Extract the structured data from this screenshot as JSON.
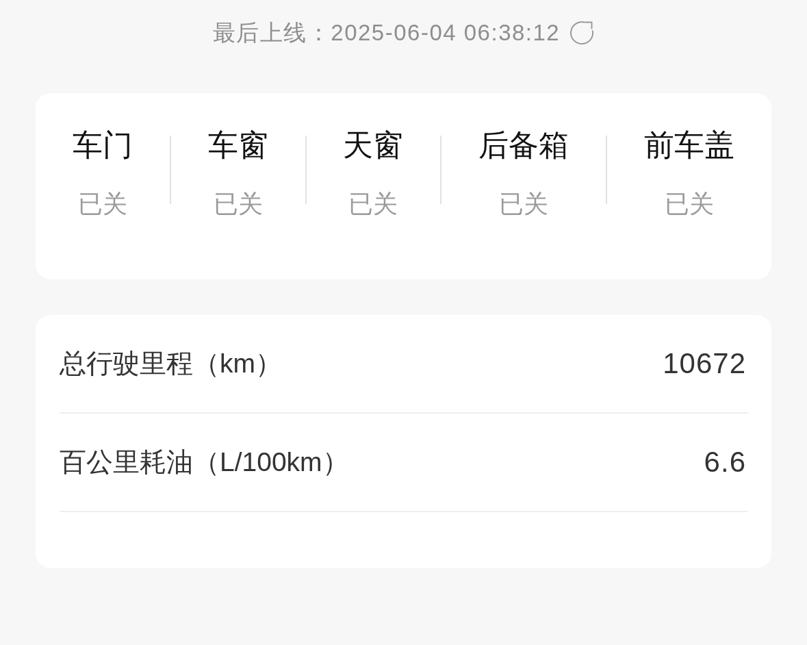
{
  "header": {
    "last_online": "最后上线：2025-06-04 06:38:12"
  },
  "status_items": [
    {
      "label": "车门",
      "status": "已关"
    },
    {
      "label": "车窗",
      "status": "已关"
    },
    {
      "label": "天窗",
      "status": "已关"
    },
    {
      "label": "后备箱",
      "status": "已关"
    },
    {
      "label": "前车盖",
      "status": "已关"
    }
  ],
  "stats": [
    {
      "label": "总行驶里程（km）",
      "value": "10672"
    },
    {
      "label": "百公里耗油（L/100km）",
      "value": "6.6"
    }
  ]
}
